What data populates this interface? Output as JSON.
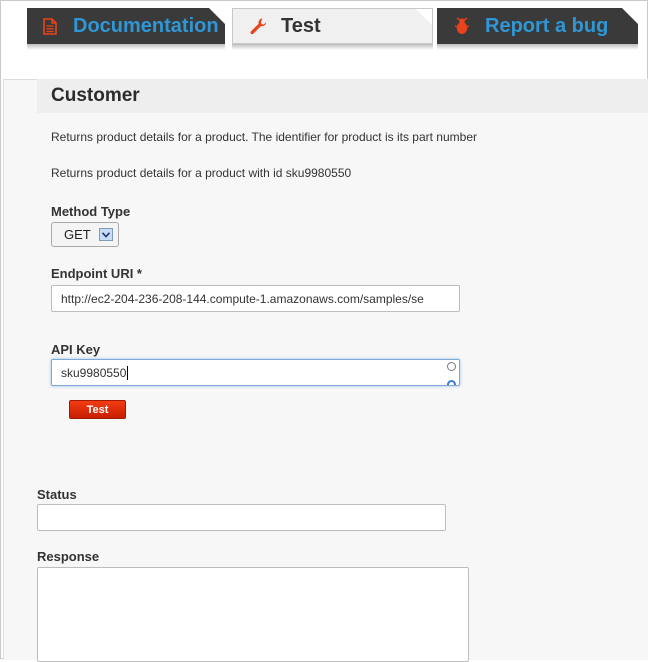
{
  "tabs": [
    {
      "label": "Documentation",
      "icon": "document-icon"
    },
    {
      "label": "Test",
      "icon": "wrench-icon",
      "active": true
    },
    {
      "label": "Report a bug",
      "icon": "bug-icon"
    }
  ],
  "colors": {
    "tab_dark": "#3a3a3a",
    "tab_text_blue": "#2f97d6",
    "icon_orange": "#e8431a",
    "button_red": "#e02e0a"
  },
  "form": {
    "title": "Customer",
    "description_1": "Returns product details for a product. The identifier for product is its part number",
    "description_2": "Returns product details for a product with id sku9980550",
    "method_label": "Method Type",
    "method_value": "GET",
    "endpoint_label": "Endpoint URI *",
    "endpoint_value": "http://ec2-204-236-208-144.compute-1.amazonaws.com/samples/se",
    "api_key_label": "API Key",
    "api_key_value": "sku9980550",
    "test_button": "Test"
  },
  "results": {
    "status_label": "Status",
    "status_value": "",
    "response_label": "Response",
    "response_value": ""
  }
}
